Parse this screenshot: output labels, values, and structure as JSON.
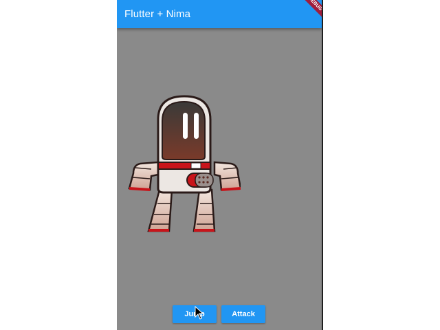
{
  "app": {
    "title": "Flutter + Nima",
    "debug_banner": "DEBUG"
  },
  "buttons": {
    "jump_label": "Jump",
    "attack_label": "Attack"
  },
  "colors": {
    "accent": "#2196f3",
    "canvas_background": "#8a8a8a",
    "debug_banner": "#a01c3c"
  },
  "icons": {
    "character": "robot-character",
    "pointer": "mouse-cursor-icon"
  }
}
